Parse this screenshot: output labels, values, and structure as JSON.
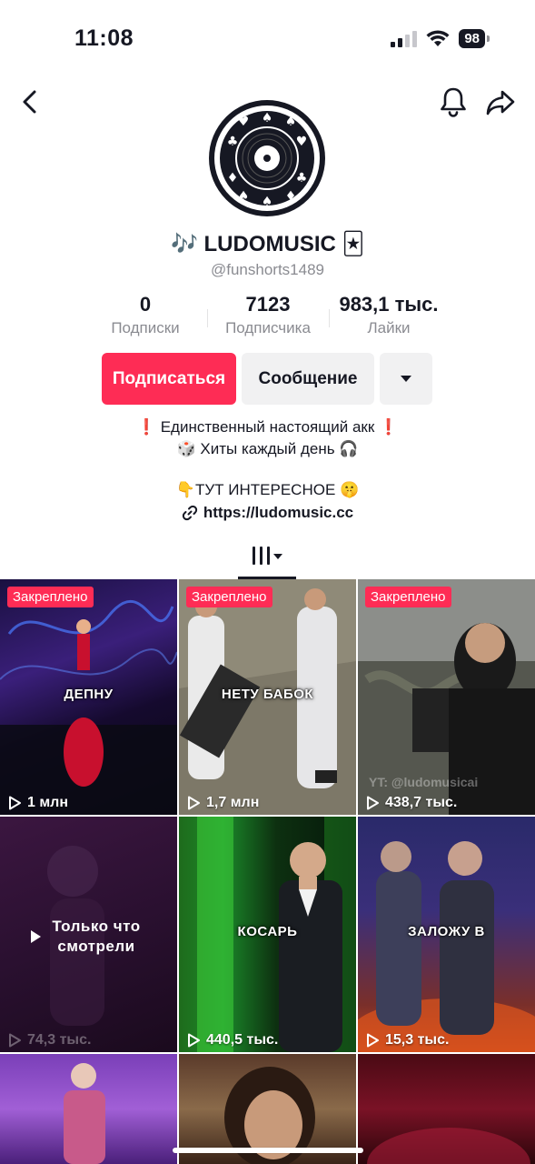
{
  "status_bar": {
    "time": "11:08",
    "battery": "98"
  },
  "profile": {
    "display_name": "🎶 LUDOMUSIC 🃏",
    "handle": "@funshorts1489",
    "stats": [
      {
        "value": "0",
        "label": "Подписки"
      },
      {
        "value": "7123",
        "label": "Подписчика"
      },
      {
        "value": "983,1 тыс.",
        "label": "Лайки"
      }
    ],
    "buttons": {
      "follow": "Подписаться",
      "message": "Сообщение"
    },
    "bio": [
      "❗ Единственный настоящий акк ❗",
      "🎲 Хиты каждый день 🎧",
      "👇ТУТ ИНТЕРЕСНОЕ 🤫"
    ],
    "link": "https://ludomusic.cc"
  },
  "grid": {
    "pinned_label": "Закреплено",
    "videos": [
      {
        "views": "1 млн",
        "overlay": "ДЕПНУ",
        "pinned": true
      },
      {
        "views": "1,7 млн",
        "overlay": "НЕТУ БАБОК",
        "pinned": true
      },
      {
        "views": "438,7 тыс.",
        "overlay": "",
        "pinned": true
      },
      {
        "views": "74,3 тыс.",
        "overlay": "Только что смотрели",
        "pinned": false
      },
      {
        "views": "440,5 тыс.",
        "overlay": "КОСАРЬ",
        "pinned": false
      },
      {
        "views": "15,3 тыс.",
        "overlay": "ЗАЛОЖУ В",
        "pinned": false
      }
    ],
    "watermark": "YT: @ludomusicai"
  },
  "colors": {
    "accent": "#fe2c55",
    "secondary_button": "#f1f1f2",
    "muted_text": "#8a8b91"
  }
}
